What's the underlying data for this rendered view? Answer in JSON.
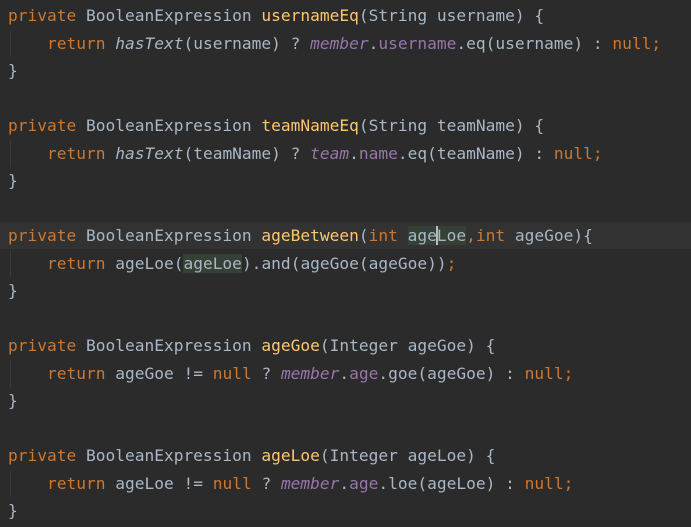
{
  "keywords": {
    "private": "private",
    "return": "return",
    "null": "null",
    "int": "int"
  },
  "types": {
    "boolean_expression": "BooleanExpression",
    "string": "String",
    "integer": "Integer"
  },
  "methods": {
    "username_eq": {
      "name": "usernameEq",
      "param": "username",
      "fn_has_text": "hasText",
      "qualifier": "member",
      "field": "username",
      "op": "eq"
    },
    "team_name_eq": {
      "name": "teamNameEq",
      "param": "teamName",
      "fn_has_text": "hasText",
      "qualifier": "team",
      "field": "name",
      "op": "eq"
    },
    "age_between": {
      "name": "ageBetween",
      "param_1_a": "age",
      "param_1_b": "Loe",
      "param_2": "ageGoe",
      "call_loe": "ageLoe",
      "arg_loe": "ageLoe",
      "and": "and",
      "call_goe": "ageGoe",
      "arg_goe": "ageGoe"
    },
    "age_goe": {
      "name": "ageGoe",
      "param": "ageGoe",
      "qualifier": "member",
      "field": "age",
      "op": "goe"
    },
    "age_loe": {
      "name": "ageLoe",
      "param": "ageLoe",
      "qualifier": "member",
      "field": "age",
      "op": "loe"
    }
  },
  "symbols": {
    "open_brace": "{",
    "close_brace": "}",
    "not_equal": "!=",
    "ternary_q": "?",
    "ternary_colon": ":"
  },
  "colors": {
    "background": "#2b2b2b",
    "keyword": "#cc7832",
    "method_decl": "#ffc66d",
    "field": "#9876aa",
    "text": "#a9b7c6",
    "current_line": "#323232",
    "usage_highlight": "#344134"
  }
}
